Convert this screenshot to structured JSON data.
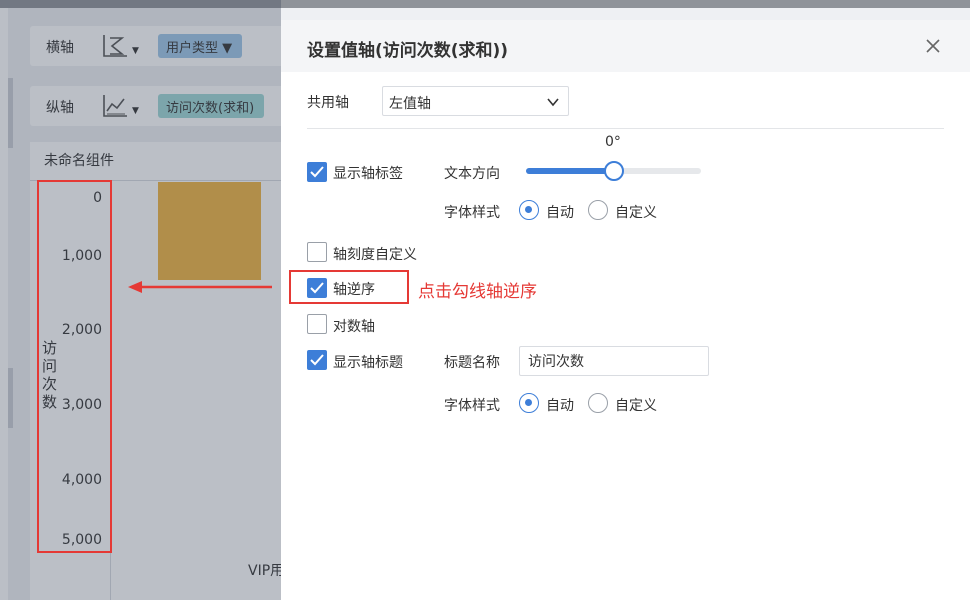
{
  "background": {
    "x_axis_label": "横轴",
    "x_axis_field": "用户类型",
    "y_axis_label": "纵轴",
    "y_axis_field": "访问次数(求和)",
    "component_name": "未命名组件",
    "chart_data": {
      "type": "bar",
      "categories": [
        "VIP用户"
      ],
      "x_tick_visible": "VIP用",
      "y_ticks": [
        "0",
        "1,000",
        "2,000",
        "3,000",
        "4,000",
        "5,000"
      ],
      "ylabel": "访问次数",
      "ylim": [
        0,
        5000
      ],
      "y_reversed": true,
      "series": [
        {
          "values": [
            1500
          ]
        }
      ],
      "bar_color": "#f0b441"
    }
  },
  "dialog": {
    "title": "设置值轴(访问次数(求和))",
    "shared_axis_label": "共用轴",
    "shared_axis_value": "左值轴",
    "show_axis_labels": {
      "label": "显示轴标签",
      "checked": true
    },
    "text_direction_label": "文本方向",
    "text_direction_value": "0°",
    "text_direction_fraction": 0.5,
    "font_style_label": "字体样式",
    "radio_auto": "自动",
    "radio_custom": "自定义",
    "custom_scale": {
      "label": "轴刻度自定义",
      "checked": false
    },
    "reverse_axis": {
      "label": "轴逆序",
      "checked": true
    },
    "log_axis": {
      "label": "对数轴",
      "checked": false
    },
    "show_axis_title": {
      "label": "显示轴标题",
      "checked": true
    },
    "title_name_label": "标题名称",
    "title_name_value": "访问次数"
  },
  "annotation": {
    "note": "点击勾线轴逆序",
    "color": "#e53935"
  },
  "colors": {
    "accent": "#3d7ed8"
  }
}
